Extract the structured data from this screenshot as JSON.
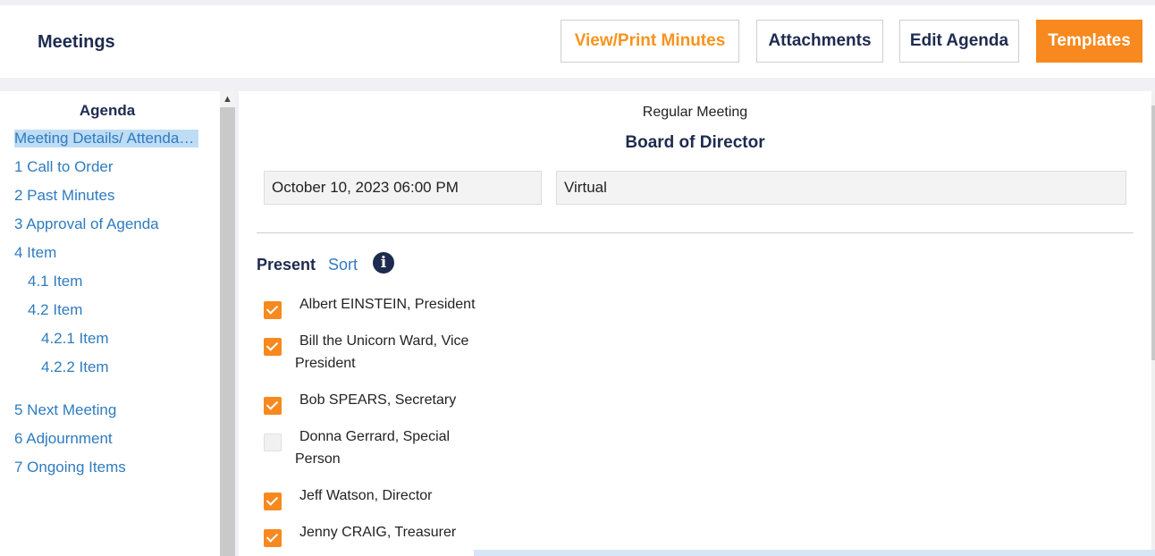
{
  "header": {
    "title": "Meetings",
    "buttons": {
      "view_print_minutes": "View/Print Minutes",
      "attachments": "Attachments",
      "edit_agenda": "Edit Agenda",
      "templates": "Templates"
    }
  },
  "sidebar": {
    "heading": "Agenda",
    "items": [
      {
        "label": "Meeting Details/ Attendance",
        "active": true
      },
      {
        "label": "1 Call to Order"
      },
      {
        "label": "2 Past Minutes"
      },
      {
        "label": "3 Approval of Agenda"
      },
      {
        "label": "4 Item"
      },
      {
        "label": "4.1 Item"
      },
      {
        "label": "4.2 Item"
      },
      {
        "label": "4.2.1 Item"
      },
      {
        "label": "4.2.2 Item"
      },
      {
        "label": "5 Next Meeting"
      },
      {
        "label": "6 Adjournment"
      },
      {
        "label": "7 Ongoing Items"
      }
    ]
  },
  "meeting": {
    "type": "Regular Meeting",
    "body": "Board of Director",
    "datetime": "October 10, 2023 06:00 PM",
    "location": "Virtual"
  },
  "attendance": {
    "present_label": "Present",
    "sort_label": "Sort",
    "attendees": [
      {
        "name": "Albert EINSTEIN, President",
        "checked": true
      },
      {
        "name": "Bill the Unicorn Ward, Vice President",
        "checked": true
      },
      {
        "name": "Bob SPEARS, Secretary",
        "checked": true
      },
      {
        "name": "Donna Gerrard, Special Person",
        "checked": false
      },
      {
        "name": "Jeff Watson, Director",
        "checked": true
      },
      {
        "name": "Jenny CRAIG, Treasurer",
        "checked": true
      }
    ]
  },
  "colors": {
    "accent_orange": "#f7891e",
    "link_blue": "#2f7bbf",
    "navy": "#1e2b4f"
  }
}
